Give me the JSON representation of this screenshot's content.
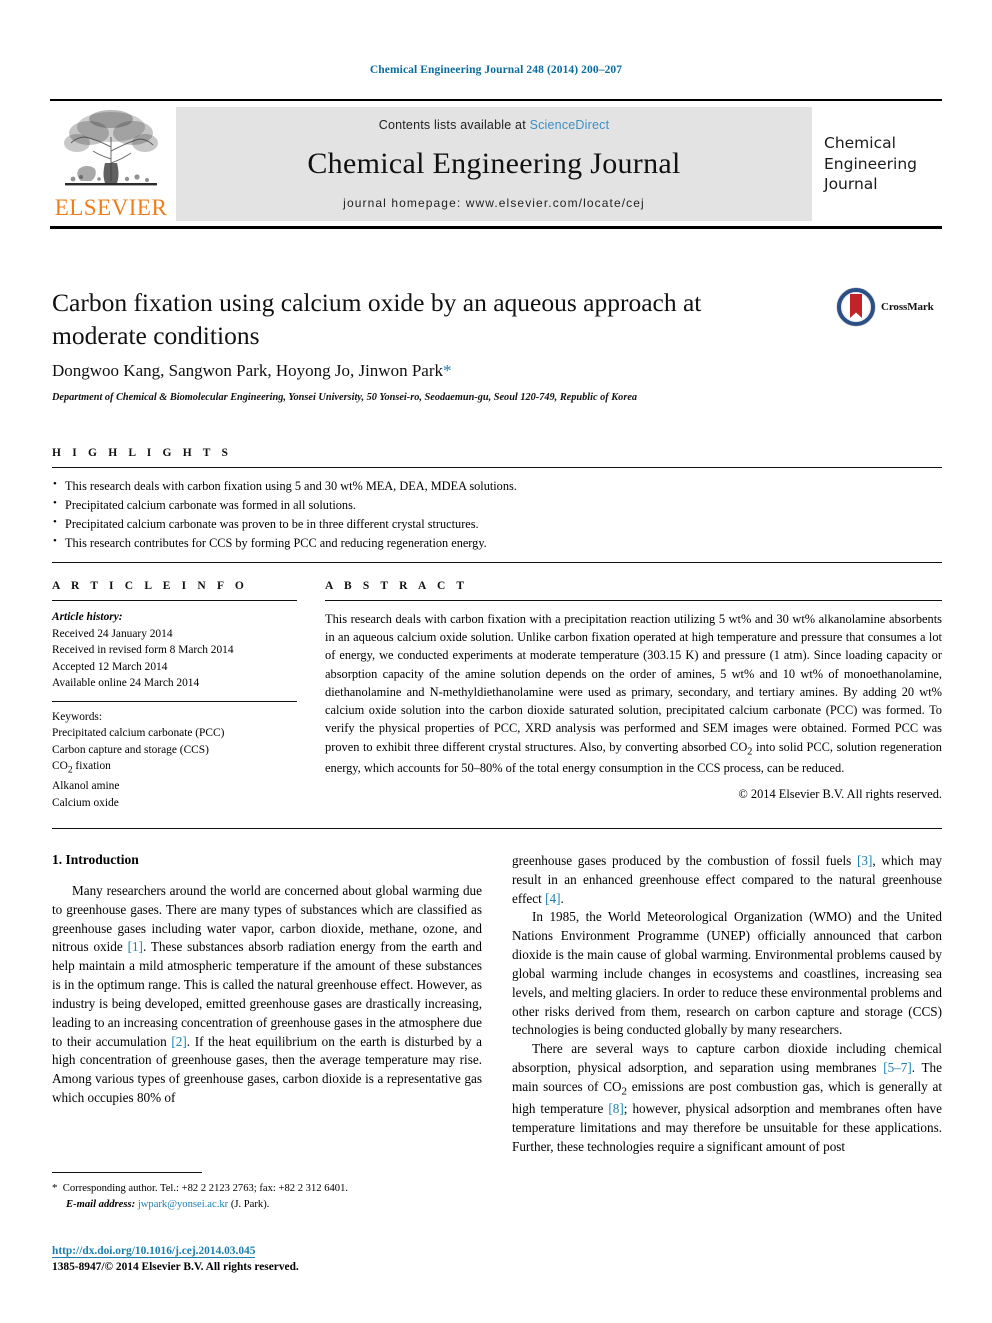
{
  "running_head": "Chemical Engineering Journal 248 (2014) 200–207",
  "masthead": {
    "publisher_logo_label": "ELSEVIER",
    "contents_prefix": "Contents lists available at",
    "contents_link": "ScienceDirect",
    "journal_name": "Chemical Engineering Journal",
    "homepage": "journal homepage: www.elsevier.com/locate/cej",
    "cover_lines": [
      "Chemical",
      "Engineering",
      "Journal"
    ]
  },
  "article": {
    "title": "Carbon fixation using calcium oxide by an aqueous approach at moderate conditions",
    "authors": "Dongwoo Kang, Sangwon Park, Hoyong Jo, Jinwon Park",
    "corresponding_marker": "*",
    "affiliation": "Department of Chemical & Biomolecular Engineering, Yonsei University, 50 Yonsei-ro, Seodaemun-gu, Seoul 120-749, Republic of Korea",
    "crossmark_label": "CrossMark"
  },
  "highlights": {
    "heading": "H I G H L I G H T S",
    "items": [
      "This research deals with carbon fixation using 5 and 30 wt% MEA, DEA, MDEA solutions.",
      "Precipitated calcium carbonate was formed in all solutions.",
      "Precipitated calcium carbonate was proven to be in three different crystal structures.",
      "This research contributes for CCS by forming PCC and reducing regeneration energy."
    ]
  },
  "article_info": {
    "heading": "A R T I C L E    I N F O",
    "history_label": "Article history:",
    "history": [
      "Received 24 January 2014",
      "Received in revised form 8 March 2014",
      "Accepted 12 March 2014",
      "Available online 24 March 2014"
    ],
    "keywords_label": "Keywords:",
    "keywords": [
      "Precipitated calcium carbonate (PCC)",
      "Carbon capture and storage (CCS)",
      "CO2 fixation",
      "Alkanol amine",
      "Calcium oxide"
    ]
  },
  "abstract": {
    "heading": "A B S T R A C T",
    "text": "This research deals with carbon fixation with a precipitation reaction utilizing 5 wt% and 30 wt% alkanolamine absorbents in an aqueous calcium oxide solution. Unlike carbon fixation operated at high temperature and pressure that consumes a lot of energy, we conducted experiments at moderate temperature (303.15 K) and pressure (1 atm). Since loading capacity or absorption capacity of the amine solution depends on the order of amines, 5 wt% and 10 wt% of monoethanolamine, diethanolamine and N-methyldiethanolamine were used as primary, secondary, and tertiary amines. By adding 20 wt% calcium oxide solution into the carbon dioxide saturated solution, precipitated calcium carbonate (PCC) was formed. To verify the physical properties of PCC, XRD analysis was performed and SEM images were obtained. Formed PCC was proven to exhibit three different crystal structures. Also, by converting absorbed CO2 into solid PCC, solution regeneration energy, which accounts for 50–80% of the total energy consumption in the CCS process, can be reduced.",
    "copyright": "© 2014 Elsevier B.V. All rights reserved."
  },
  "body": {
    "section_heading": "1. Introduction",
    "left_paragraphs": [
      "Many researchers around the world are concerned about global warming due to greenhouse gases. There are many types of substances which are classified as greenhouse gases including water vapor, carbon dioxide, methane, ozone, and nitrous oxide [1]. These substances absorb radiation energy from the earth and help maintain a mild atmospheric temperature if the amount of these substances is in the optimum range. This is called the natural greenhouse effect. However, as industry is being developed, emitted greenhouse gases are drastically increasing, leading to an increasing concentration of greenhouse gases in the atmosphere due to their accumulation [2]. If the heat equilibrium on the earth is disturbed by a high concentration of greenhouse gases, then the average temperature may rise. Among various types of greenhouse gases, carbon dioxide is a representative gas which occupies 80% of"
    ],
    "right_paragraphs": [
      "greenhouse gases produced by the combustion of fossil fuels [3], which may result in an enhanced greenhouse effect compared to the natural greenhouse effect [4].",
      "In 1985, the World Meteorological Organization (WMO) and the United Nations Environment Programme (UNEP) officially announced that carbon dioxide is the main cause of global warming. Environmental problems caused by global warming include changes in ecosystems and coastlines, increasing sea levels, and melting glaciers. In order to reduce these environmental problems and other risks derived from them, research on carbon capture and storage (CCS) technologies is being conducted globally by many researchers.",
      "There are several ways to capture carbon dioxide including chemical absorption, physical adsorption, and separation using membranes [5–7]. The main sources of CO2 emissions are post combustion gas, which is generally at high temperature [8]; however, physical adsorption and membranes often have temperature limitations and may therefore be unsuitable for these applications. Further, these technologies require a significant amount of post"
    ]
  },
  "footer": {
    "corresponding_note": "Corresponding author. Tel.: +82 2 2123 2763; fax: +82 2 312 6401.",
    "email_label": "E-mail address:",
    "email": "jwpark@yonsei.ac.kr",
    "email_owner": "(J. Park).",
    "doi": "http://dx.doi.org/10.1016/j.cej.2014.03.045",
    "issn_line": "1385-8947/© 2014 Elsevier B.V. All rights reserved."
  },
  "colors": {
    "link_blue": "#1b7fb0",
    "sciencedirect_blue": "#3c8fc4",
    "elsevier_orange": "#ef7d1a",
    "band_gray": "#e3e3e3"
  }
}
